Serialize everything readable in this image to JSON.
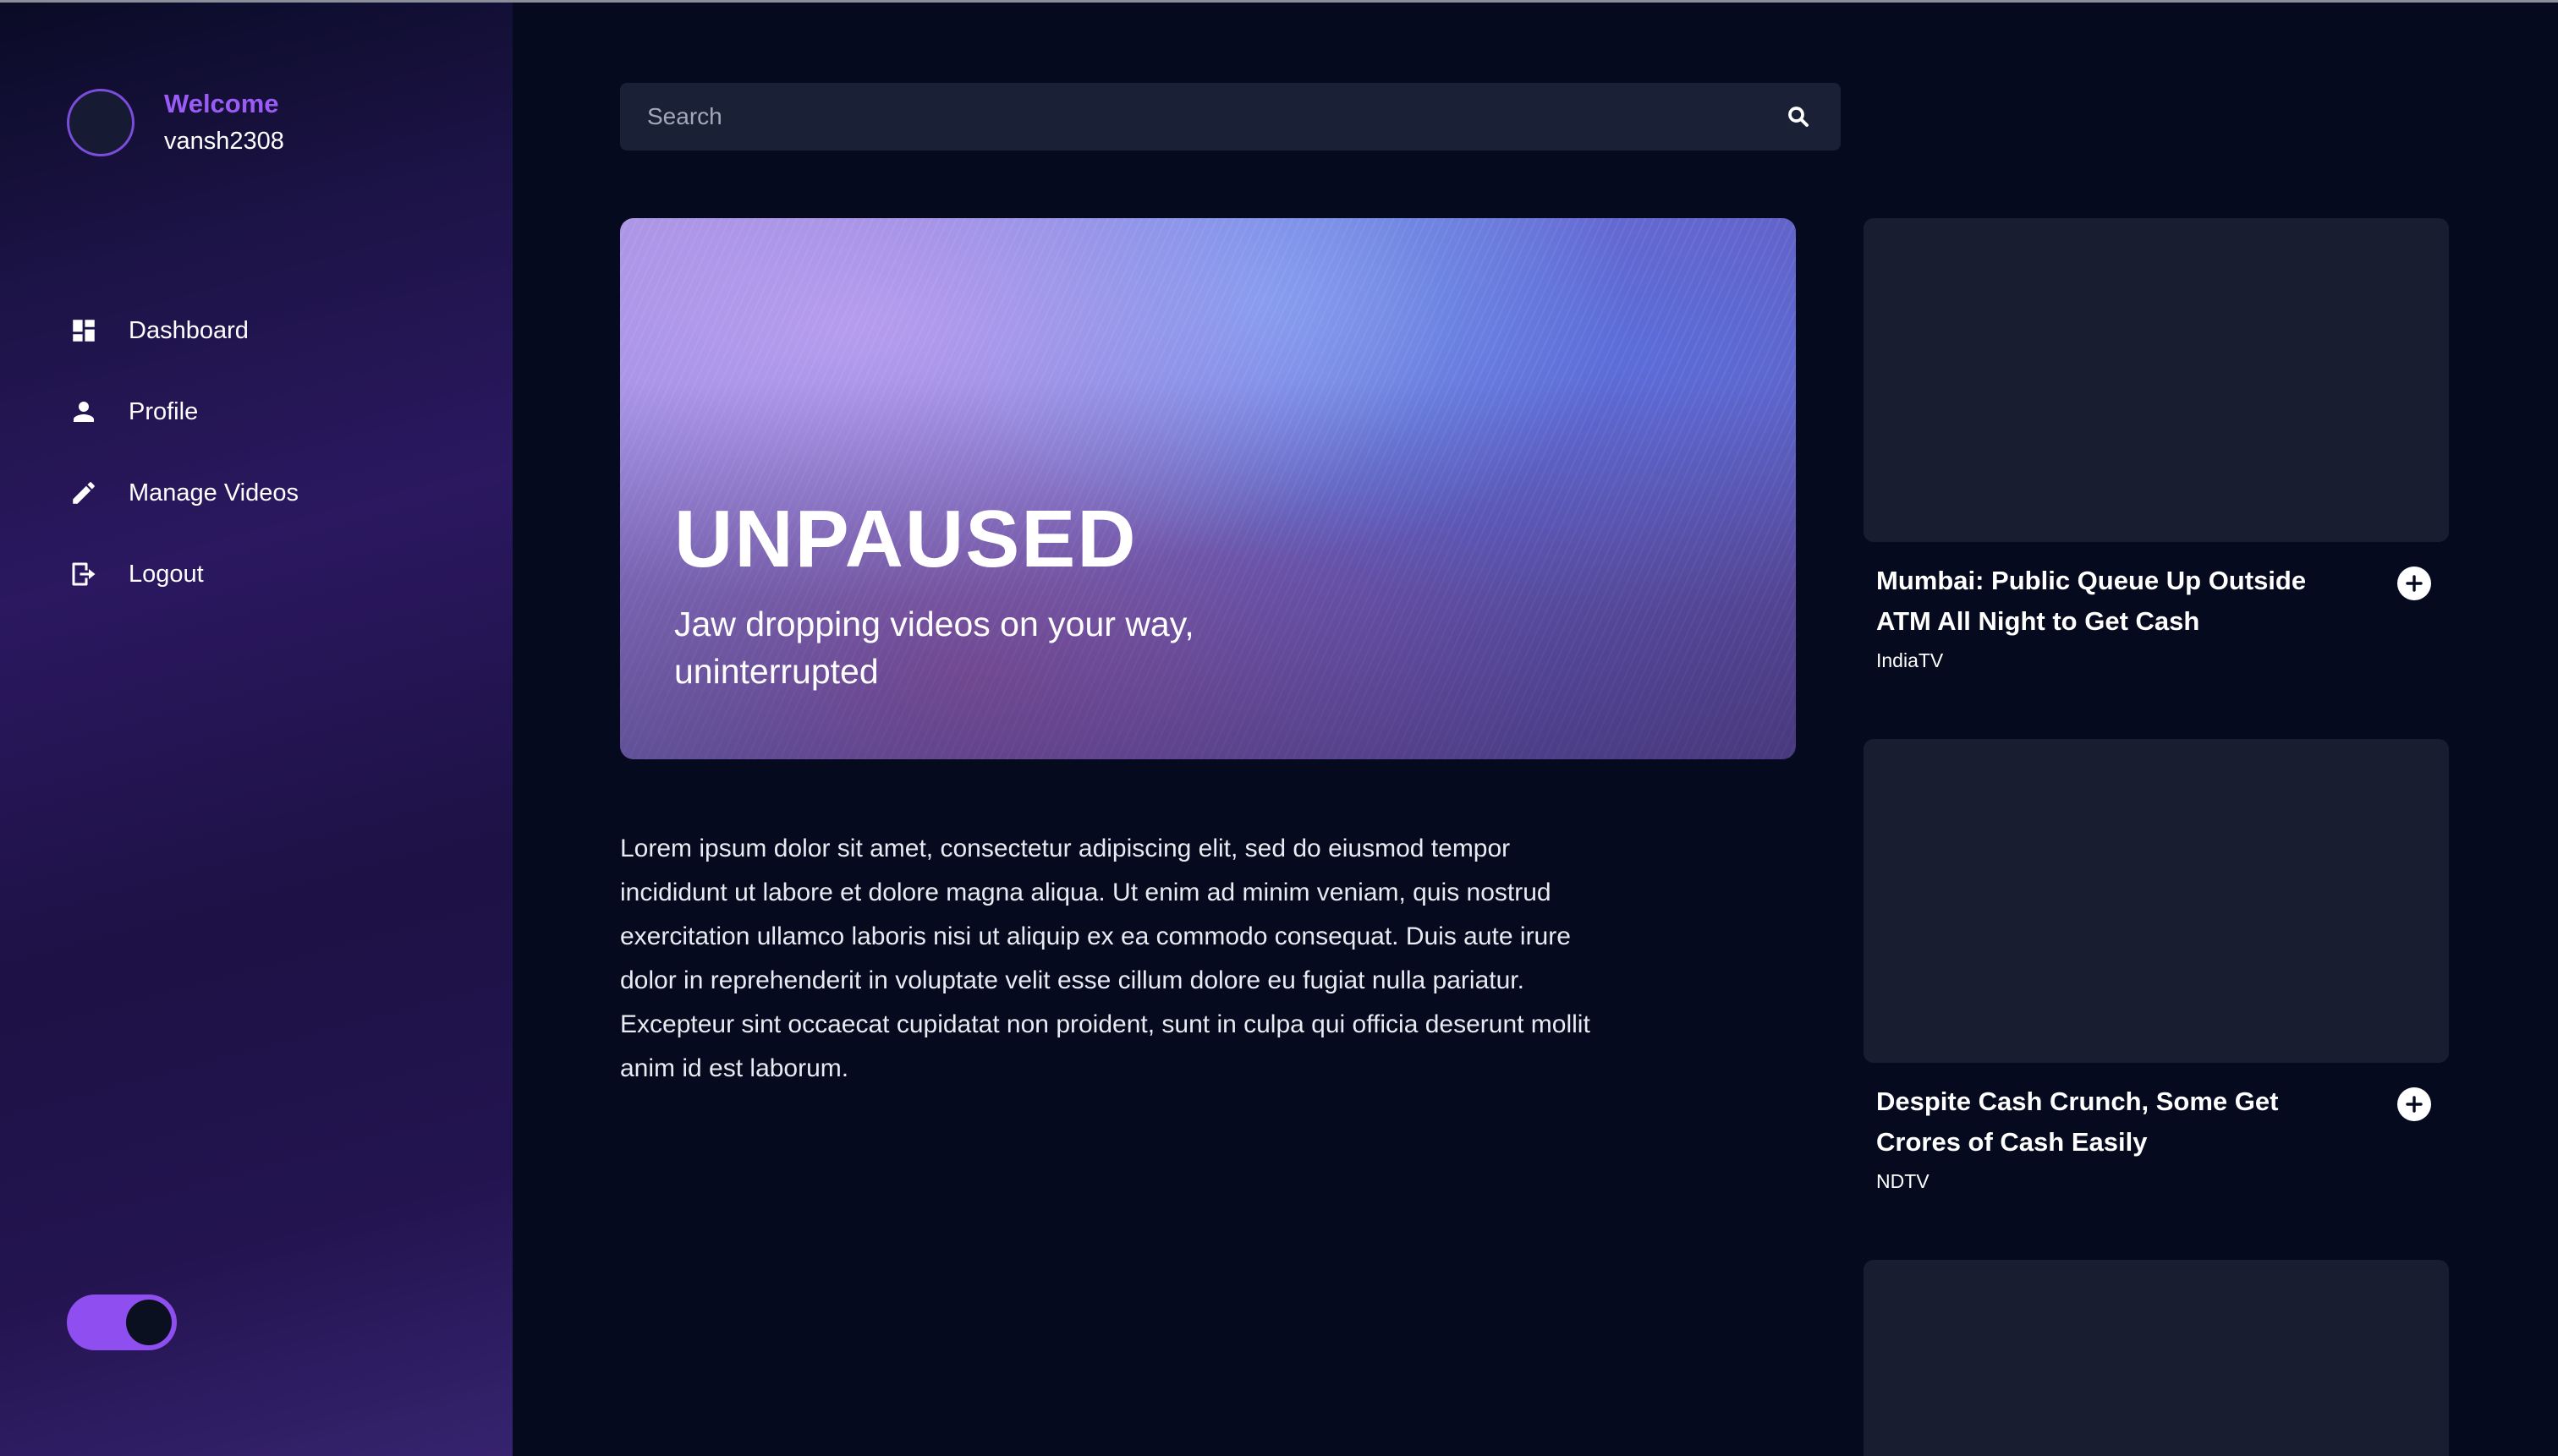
{
  "sidebar": {
    "welcome": "Welcome",
    "username": "vansh2308",
    "items": [
      {
        "label": "Dashboard",
        "icon": "dashboard-icon"
      },
      {
        "label": "Profile",
        "icon": "person-icon"
      },
      {
        "label": "Manage Videos",
        "icon": "pencil-icon"
      },
      {
        "label": "Logout",
        "icon": "logout-icon"
      }
    ],
    "theme_toggle_on": true
  },
  "search": {
    "placeholder": "Search",
    "value": ""
  },
  "hero": {
    "title": "UNPAUSED",
    "subtitle": "Jaw dropping videos on your way, uninterrupted"
  },
  "description": "Lorem ipsum dolor sit amet, consectetur adipiscing elit, sed do eiusmod tempor incididunt ut labore et dolore magna aliqua. Ut enim ad minim veniam, quis nostrud exercitation ullamco laboris nisi ut aliquip ex ea commodo consequat. Duis aute irure dolor in reprehenderit in voluptate velit esse cillum dolore eu fugiat nulla pariatur. Excepteur sint occaecat cupidatat non proident, sunt in culpa qui officia deserunt mollit anim id est laborum.",
  "videos": [
    {
      "title": "Mumbai: Public Queue Up Outside ATM All Night to Get Cash",
      "source": "IndiaTV"
    },
    {
      "title": "Despite Cash Crunch, Some Get Crores of Cash Easily",
      "source": "NDTV"
    },
    {
      "title": "",
      "source": ""
    }
  ],
  "colors": {
    "background": "#050a1f",
    "accent": "#9b5cf6",
    "card": "#181d30",
    "search_bg": "#1a2035"
  }
}
